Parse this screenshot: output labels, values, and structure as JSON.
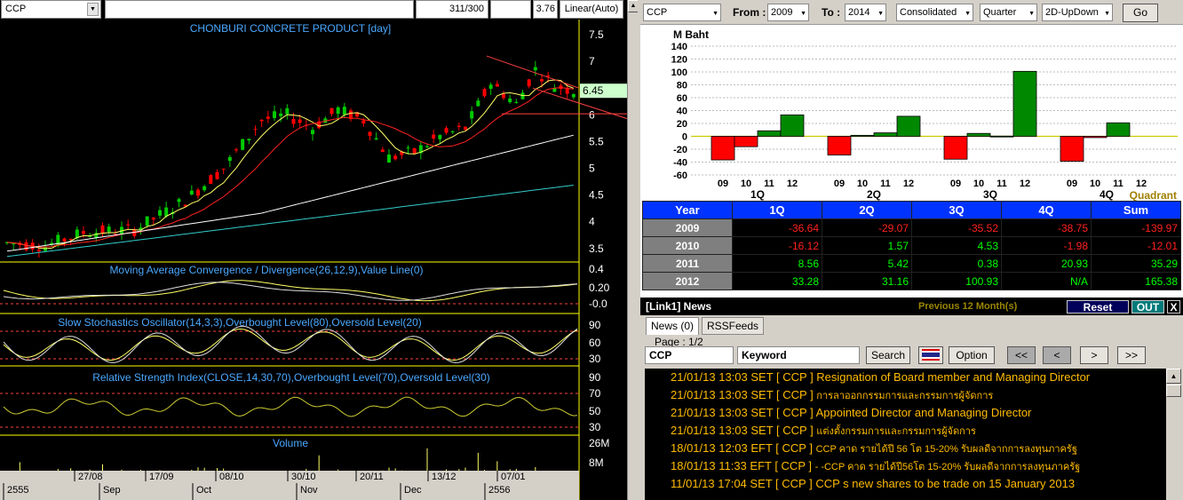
{
  "left_toolbar": {
    "symbol": "CCP",
    "count": "311/300",
    "price": "3.76",
    "scale": "Linear(Auto)"
  },
  "price_chart": {
    "title": "CHONBURI CONCRETE PRODUCT [day]",
    "price_ticks": [
      "7.5",
      "7",
      "6.5",
      "6",
      "5.5",
      "5",
      "4.5",
      "4",
      "3.5"
    ],
    "last_price": "6.45",
    "macd_title": "Moving Average Convergence / Divergence(26,12,9),Value Line(0)",
    "macd_ticks": [
      "0.4",
      "0.20",
      "-0.0"
    ],
    "stoch_title": "Slow Stochastics Oscillator(14,3,3),Overbought Level(80),Oversold Level(20)",
    "stoch_ticks": [
      "90",
      "60",
      "30"
    ],
    "rsi_title": "Relative Strength Index(CLOSE,14,30,70),Overbought Level(70),Oversold Level(30)",
    "rsi_ticks": [
      "90",
      "70",
      "50",
      "30"
    ],
    "volume_title": "Volume",
    "volume_ticks": [
      "26M",
      "8M"
    ],
    "date_ticks_top": [
      "27/08",
      "17/09",
      "08/10",
      "30/10",
      "20/11",
      "13/12",
      "07/01"
    ],
    "date_ticks_bottom": [
      "2555",
      "Sep",
      "Oct",
      "Nov",
      "Dec",
      "2556"
    ],
    "colors": {
      "candle_up": "#00cc00",
      "candle_down": "#ff0000",
      "ma_fast": "#ffff66",
      "ma_mid": "#ff2020",
      "ma_slow": "#ffffff",
      "ma_long": "#33cccc"
    }
  },
  "controls": {
    "symbol": "CCP",
    "from_label": "From :",
    "from_value": "2009",
    "to_label": "To :",
    "to_value": "2014",
    "mode": "Consolidated",
    "period": "Quarter",
    "view": "2D-UpDown",
    "go_label": "Go"
  },
  "chart_data": {
    "type": "bar",
    "title": "",
    "ylabel": "M Baht",
    "xlabel": "Quadrant",
    "ylim": [
      -60,
      140
    ],
    "yticks": [
      140,
      120,
      100,
      80,
      60,
      40,
      20,
      0,
      -20,
      -40,
      -60
    ],
    "groups": [
      "1Q",
      "2Q",
      "3Q",
      "4Q"
    ],
    "categories": [
      "09",
      "10",
      "11",
      "12"
    ],
    "series": [
      {
        "group": "1Q",
        "values": [
          -36.64,
          -16.12,
          8.56,
          33.28
        ]
      },
      {
        "group": "2Q",
        "values": [
          -29.07,
          1.57,
          5.42,
          31.16
        ]
      },
      {
        "group": "3Q",
        "values": [
          -35.52,
          4.53,
          0.38,
          100.93
        ]
      },
      {
        "group": "4Q",
        "values": [
          -38.75,
          -1.98,
          20.93,
          null
        ]
      }
    ]
  },
  "quarter_table": {
    "headers": [
      "Year",
      "1Q",
      "2Q",
      "3Q",
      "4Q",
      "Sum"
    ],
    "rows": [
      {
        "year": "2009",
        "cells": [
          "-36.64",
          "-29.07",
          "-35.52",
          "-38.75",
          "-139.97"
        ]
      },
      {
        "year": "2010",
        "cells": [
          "-16.12",
          "1.57",
          "4.53",
          "-1.98",
          "-12.01"
        ]
      },
      {
        "year": "2011",
        "cells": [
          "8.56",
          "5.42",
          "0.38",
          "20.93",
          "35.29"
        ]
      },
      {
        "year": "2012",
        "cells": [
          "33.28",
          "31.16",
          "100.93",
          "N/A",
          "165.38"
        ]
      }
    ]
  },
  "news": {
    "title": "[Link1] News",
    "previous": "Previous 12 Month(s)",
    "reset": "Reset",
    "out": "OUT",
    "close": "X",
    "tab_news": "News (0)",
    "tab_rss": "RSSFeeds",
    "page": "Page : 1/2",
    "symbol": "CCP",
    "keyword": "Keyword",
    "search": "Search",
    "option": "Option",
    "first": "<<",
    "prev": "<",
    "next": ">",
    "last": ">>",
    "items": [
      {
        "date": "21/01/13 13:03",
        "src": "SET",
        "sym": "[ CCP ]",
        "text": "Resignation of Board member and Managing Director",
        "thai": false
      },
      {
        "date": "21/01/13 13:03",
        "src": "SET",
        "sym": "[ CCP ]",
        "text": "การลาออกกรรมการและกรรมการผู้จัดการ",
        "thai": true
      },
      {
        "date": "21/01/13 13:03",
        "src": "SET",
        "sym": "[ CCP ]",
        "text": "Appointed  Director and Managing Director",
        "thai": false
      },
      {
        "date": "21/01/13 13:03",
        "src": "SET",
        "sym": "[ CCP ]",
        "text": "แต่งตั้งกรรมการและกรรมการผู้จัดการ",
        "thai": true
      },
      {
        "date": "18/01/13 12:03",
        "src": "EFT",
        "sym": "[ CCP ]",
        "text": "CCP  คาด รายได้ปี 56 โต 15-20% รับผลดีจากการลงทุนภาครัฐ",
        "thai": true
      },
      {
        "date": "18/01/13 11:33",
        "src": "EFT",
        "sym": "[ CCP ]",
        "text": "- -CCP  คาด รายได้ปี56โต 15-20% รับผลดีจากการลงทุนภาครัฐ",
        "thai": true
      },
      {
        "date": "11/01/13 17:04",
        "src": "SET",
        "sym": "[ CCP ]",
        "text": "CCP s new shares to be trade on 15 January 2013",
        "thai": false
      }
    ]
  }
}
